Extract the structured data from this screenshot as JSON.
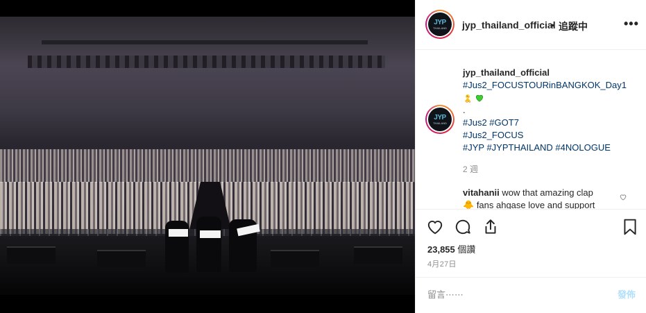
{
  "post": {
    "username": "jyp_thailand_official",
    "separator": "•",
    "follow_state": "追蹤中",
    "more_label": "•••",
    "avatar_text": "JYP",
    "avatar_sub": "THAILAND",
    "photo_signs": [
      "",
      "",
      ""
    ]
  },
  "caption": {
    "username": "jyp_thailand_official",
    "line1": "#Jus2_FOCUSTOURinBANGKOK_Day1",
    "emojis": [
      "chick-emoji",
      "green-heart-emoji"
    ],
    "dot": ".",
    "line3": "#Jus2 #GOT7",
    "line4": "#Jus2_FOCUS",
    "line5": "#JYP #JYPTHAILAND #4NOLOGUE",
    "time": "2 週"
  },
  "comment": {
    "username": "vitahanii",
    "text": "wow that amazing clap",
    "text2": "fans ahgase love and support"
  },
  "actions": {
    "icons": [
      "heart-icon",
      "comment-icon",
      "share-icon",
      "bookmark-icon"
    ],
    "likes_count": "23,855",
    "likes_label": "個讚",
    "date": "4月27日"
  },
  "comment_box": {
    "placeholder": "留言⋯⋯",
    "post_label": "發佈"
  },
  "colors": {
    "hashtag": "#003569",
    "muted": "#8e8e8e",
    "post_disabled": "#b2dffc",
    "text": "#262626"
  }
}
